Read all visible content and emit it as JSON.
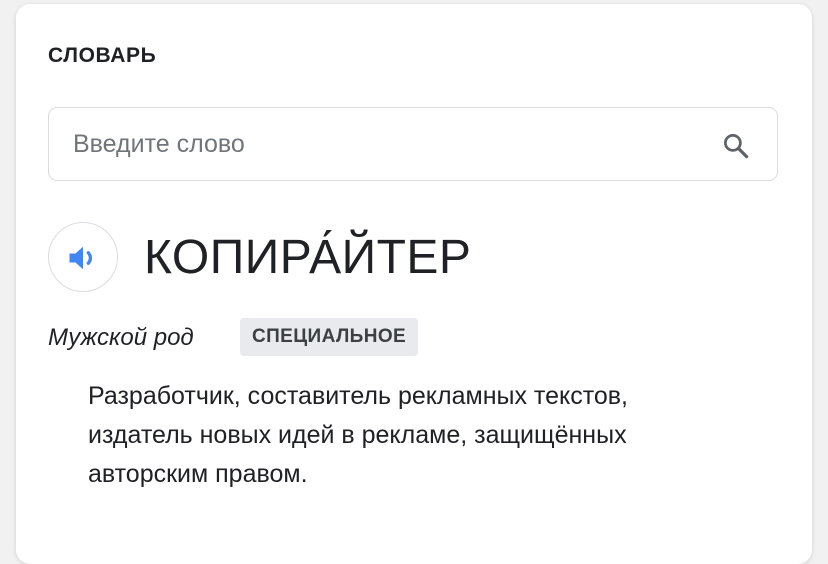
{
  "dictionary": {
    "section_title": "СЛОВАРЬ",
    "search": {
      "placeholder": "Введите слово",
      "value": "",
      "icon": "search-icon"
    },
    "entry": {
      "pronounce_icon": "speaker-icon",
      "headword": "КОПИРА́ЙТЕР",
      "gender": "Мужской род",
      "label": "СПЕЦИАЛЬНОЕ",
      "definition": "Разработчик, составитель рекламных текстов, издатель новых идей в рекламе, защищённых авторским правом."
    },
    "colors": {
      "accent": "#4285f4",
      "text": "#202124",
      "secondary_text": "#70757a",
      "badge_bg": "#e8eaed"
    }
  }
}
